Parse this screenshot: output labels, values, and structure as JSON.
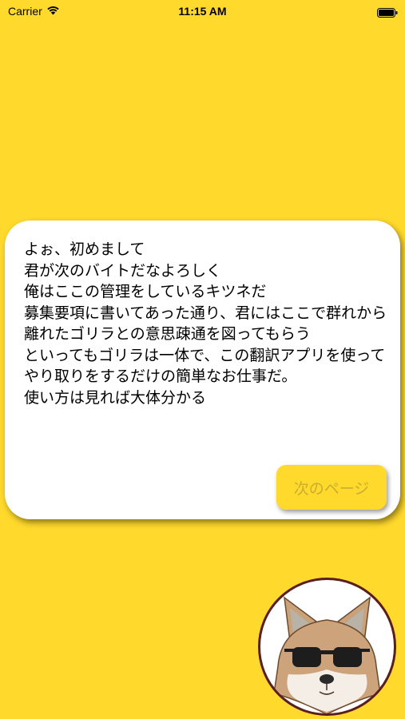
{
  "status_bar": {
    "carrier": "Carrier",
    "time": "11:15 AM",
    "icons": [
      "wifi-icon",
      "battery-icon"
    ]
  },
  "dialog": {
    "text": "よぉ、初めまして\n君が次のバイトだなよろしく\n俺はここの管理をしているキツネだ\n募集要項に書いてあった通り、君にはここで群れから離れたゴリラとの意思疎通を図ってもらう\nといってもゴリラは一体で、この翻訳アプリを使ってやり取りをするだけの簡単なお仕事だ。\n使い方は見れば大体分かる",
    "next_button_label": "次のページ"
  },
  "avatar": {
    "icon": "fox-with-sunglasses-icon"
  },
  "colors": {
    "background": "#FFD92B",
    "card": "#FFFFFF",
    "button_text_disabled": "#C9AE2F",
    "avatar_border": "#5A1E1E"
  }
}
